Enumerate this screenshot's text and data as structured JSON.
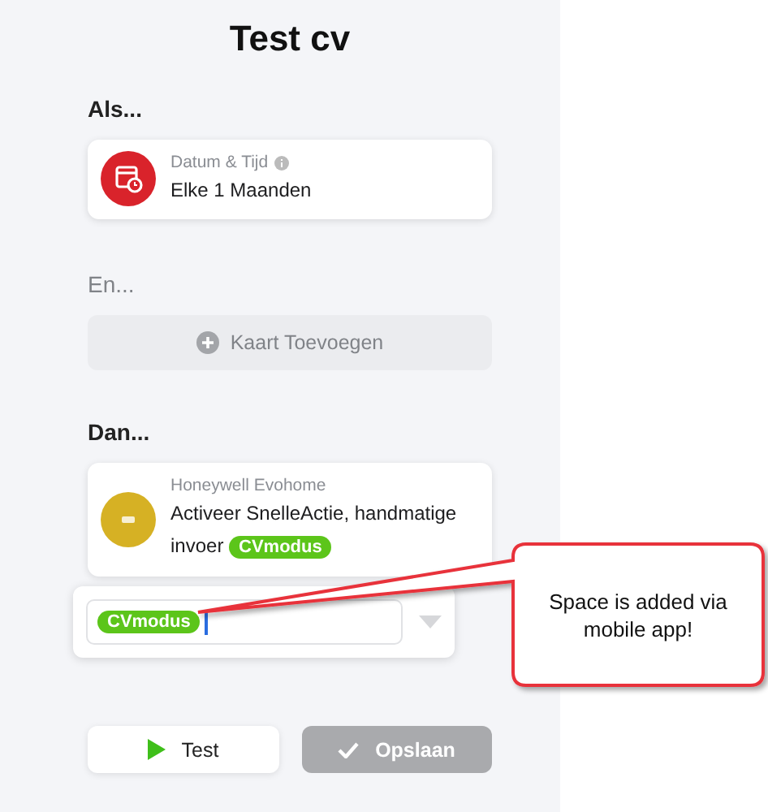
{
  "title": "Test cv",
  "when": {
    "heading": "Als...",
    "disabled": false,
    "card": {
      "kind": "datetime",
      "app": "Datum & Tijd",
      "info": true,
      "summary": "Elke 1 Maanden"
    }
  },
  "and": {
    "heading": "En...",
    "disabled": true,
    "add_button": "Kaart Toevoegen"
  },
  "then": {
    "heading": "Dan...",
    "disabled": false,
    "card": {
      "kind": "device",
      "app": "Honeywell Evohome",
      "info": false,
      "summary": "Activeer SnelleActie, handmatige invoer",
      "tag": "CVmodus"
    }
  },
  "editor": {
    "tag": "CVmodus"
  },
  "callout": "Space is added via mobile app!",
  "buttons": [
    {
      "kind": "test",
      "label": "Test",
      "disabled": false
    },
    {
      "kind": "save",
      "label": "Opslaan",
      "disabled": true
    }
  ]
}
